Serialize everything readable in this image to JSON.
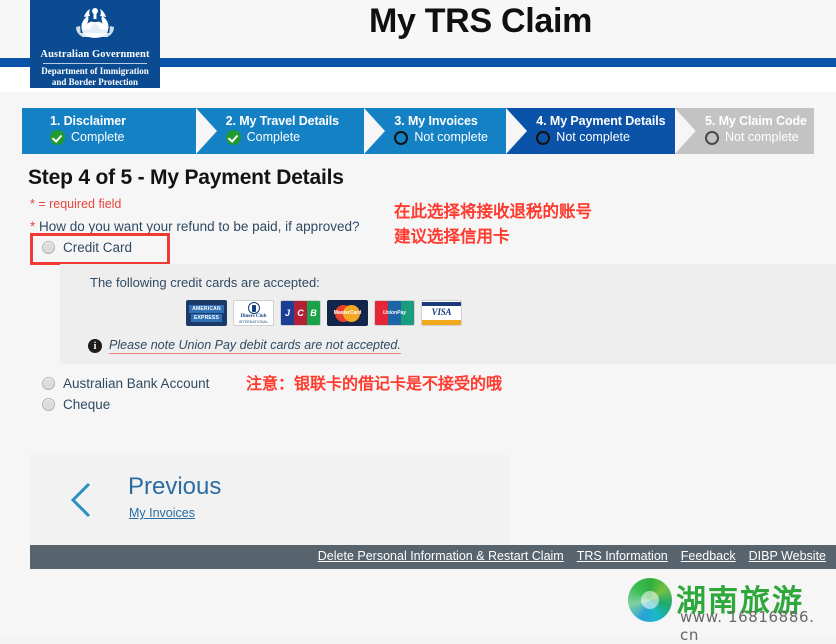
{
  "header": {
    "crest_emblem_icon": "australian-coat-of-arms",
    "crest_government": "Australian Government",
    "crest_department_line1": "Department of Immigration",
    "crest_department_line2": "and Border Protection",
    "app_title": "My TRS Claim",
    "rule_color": "#0a53a8"
  },
  "steps": [
    {
      "title": "1. Disclaimer",
      "state": "Complete",
      "icon": "check-icon",
      "status": "complete"
    },
    {
      "title": "2. My Travel Details",
      "state": "Complete",
      "icon": "check-icon",
      "status": "complete"
    },
    {
      "title": "3. My Invoices",
      "state": "Not complete",
      "icon": "circle-icon",
      "status": "incomplete"
    },
    {
      "title": "4. My Payment Details",
      "state": "Not complete",
      "icon": "circle-icon",
      "status": "current"
    },
    {
      "title": "5. My Claim Code",
      "state": "Not complete",
      "icon": "circle-icon",
      "status": "disabled"
    }
  ],
  "form": {
    "heading": "Step 4 of 5 - My Payment Details",
    "required_note": "* = required field",
    "question_star": "*",
    "question": " How do you want your refund to be paid, if approved?",
    "options": [
      {
        "label": "Credit Card",
        "selected": false
      },
      {
        "label": "Australian Bank Account",
        "selected": false
      },
      {
        "label": "Cheque",
        "selected": false
      }
    ]
  },
  "card_panel": {
    "title": "The following credit cards are accepted:",
    "cards": [
      {
        "name": "amex-card-icon",
        "line1": "AMERICAN",
        "line2": "EXPRESS"
      },
      {
        "name": "diners-club-card-icon",
        "line1": "Diners Club",
        "line2": "INTERNATIONAL"
      },
      {
        "name": "jcb-card-icon",
        "line1": "J",
        "line2": "C",
        "line3": "B"
      },
      {
        "name": "mastercard-card-icon",
        "line1": "MasterCard"
      },
      {
        "name": "unionpay-card-icon",
        "line1": "UnionPay",
        "line2": "银联"
      },
      {
        "name": "visa-card-icon",
        "line1": "VISA"
      }
    ],
    "note_icon": "info-icon",
    "note": "Please note Union Pay debit cards are not accepted."
  },
  "annotations": {
    "credit_card_note_line1": "在此选择将接收退税的账号",
    "credit_card_note_line2": "建议选择信用卡",
    "unionpay_note": "注意：银联卡的借记卡是不接受的哦",
    "highlight_color": "#ef3b33",
    "text_color": "#ff3b30"
  },
  "navigation": {
    "chevron_icon": "chevron-left-icon",
    "previous_label": "Previous",
    "previous_target": "My Invoices"
  },
  "footer": {
    "links": [
      "Delete Personal Information & Restart Claim",
      "TRS Information",
      "Feedback",
      "DIBP Website"
    ]
  },
  "watermark": {
    "logo_icon": "hunan-travel-logo-icon",
    "text": "湖南旅游",
    "url": "www. 16816886. cn"
  }
}
